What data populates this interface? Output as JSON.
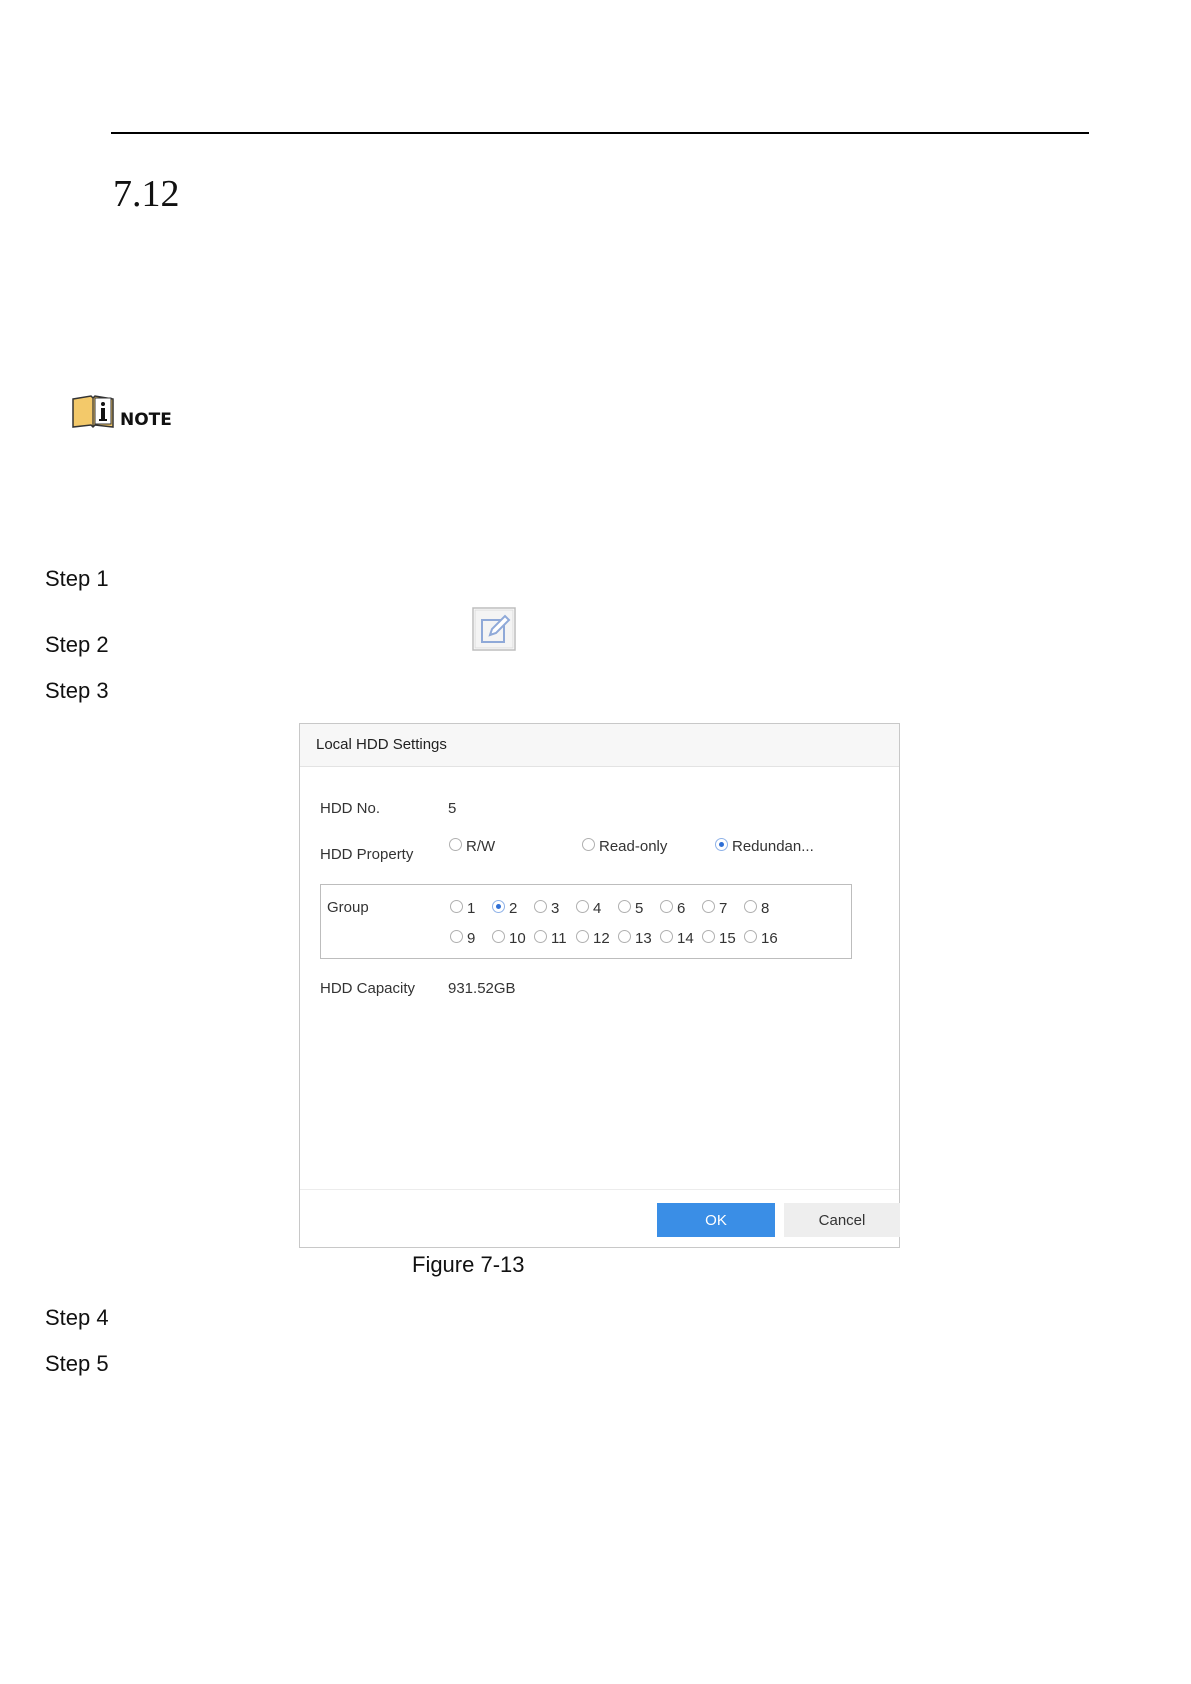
{
  "section": {
    "number": "7.12"
  },
  "note": {
    "label": "NOTE"
  },
  "steps": [
    "Step 1",
    "Step 2",
    "Step 3",
    "Step 4",
    "Step 5"
  ],
  "icons": {
    "note": "note-info-icon",
    "edit": "edit-icon"
  },
  "dialog": {
    "title": "Local HDD Settings",
    "hdd_no_label": "HDD No.",
    "hdd_no_value": "5",
    "property_label": "HDD Property",
    "property_options": [
      "R/W",
      "Read-only",
      "Redundan..."
    ],
    "property_selected": "Redundan...",
    "group_label": "Group",
    "group_options": [
      "1",
      "2",
      "3",
      "4",
      "5",
      "6",
      "7",
      "8",
      "9",
      "10",
      "11",
      "12",
      "13",
      "14",
      "15",
      "16"
    ],
    "group_selected": "2",
    "capacity_label": "HDD Capacity",
    "capacity_value": "931.52GB",
    "ok_label": "OK",
    "cancel_label": "Cancel",
    "accent_color": "#3a8ee6"
  },
  "caption": "Figure 7-13"
}
